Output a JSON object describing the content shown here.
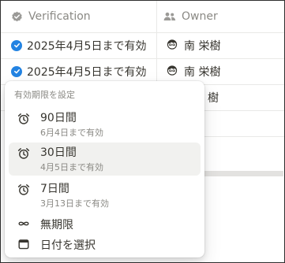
{
  "table": {
    "headers": {
      "verification": "Verification",
      "owner": "Owner"
    },
    "rows": [
      {
        "verification": "2025年4月5日まで有効",
        "owner": "南 栄樹"
      },
      {
        "verification": "2025年4月5日まで有効",
        "owner": "南 栄樹"
      },
      {
        "verification": "",
        "owner": "樹"
      }
    ]
  },
  "menu": {
    "title": "有効期限を設定",
    "options": [
      {
        "label": "90日間",
        "sub": "6月4日まで有効",
        "icon": "alarm-clock-icon"
      },
      {
        "label": "30日間",
        "sub": "4月5日まで有効",
        "icon": "alarm-clock-icon",
        "selected": true
      },
      {
        "label": "7日間",
        "sub": "3月13日まで有効",
        "icon": "alarm-clock-icon"
      },
      {
        "label": "無期限",
        "icon": "infinity-icon"
      },
      {
        "label": "日付を選択",
        "icon": "calendar-icon"
      }
    ]
  },
  "colors": {
    "accent": "#2383e2",
    "text": "#37352f",
    "muted": "#8a8984",
    "selected_bg": "#f1f1ef"
  }
}
